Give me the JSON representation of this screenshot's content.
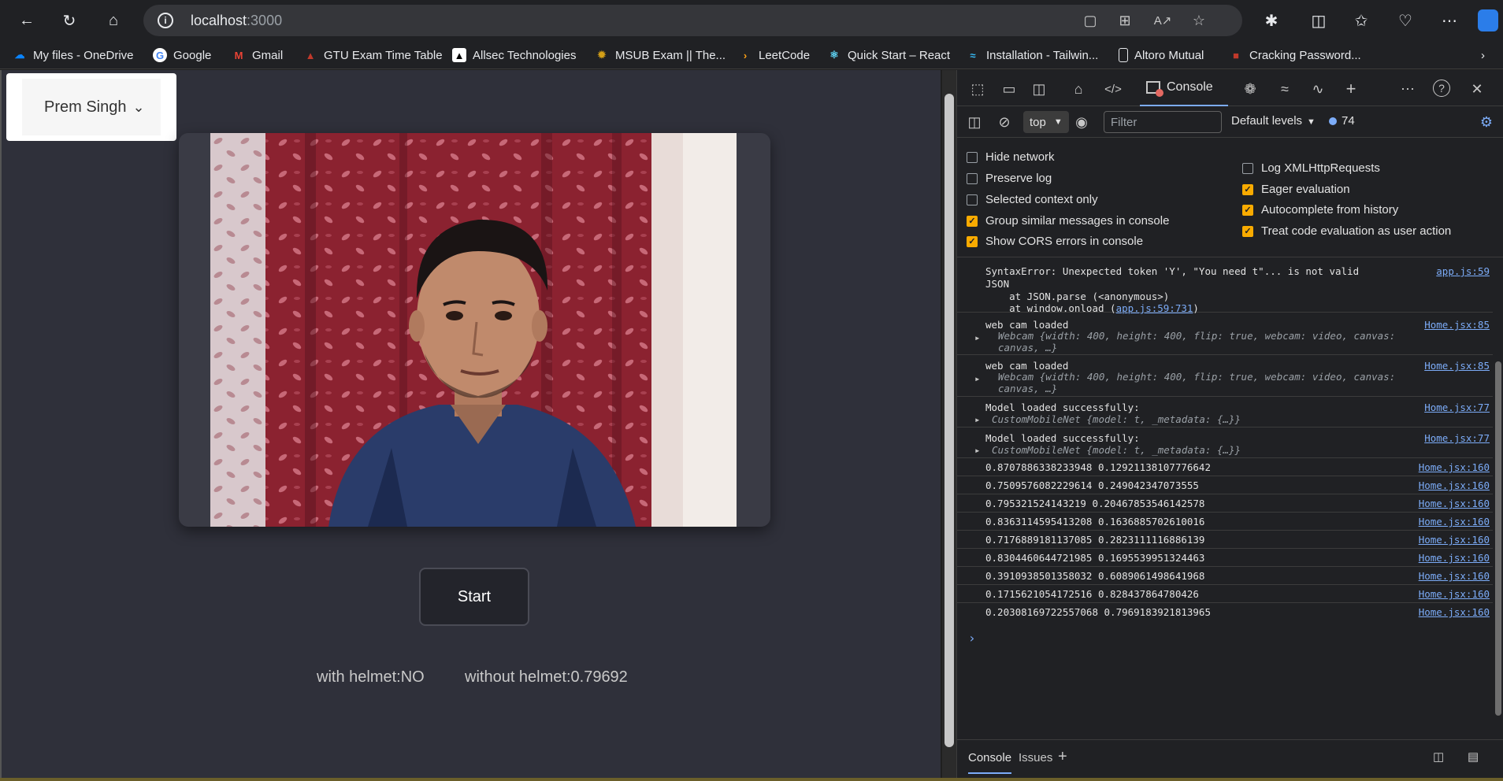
{
  "browser": {
    "url_host": "localhost",
    "url_port": ":3000",
    "bookmarks": [
      {
        "label": "My files - OneDrive",
        "icon": "onedrive-icon",
        "color": "#0a84ff"
      },
      {
        "label": "Google",
        "icon": "google-icon",
        "color": "#ffffff"
      },
      {
        "label": "Gmail",
        "icon": "gmail-icon",
        "color": "#ea4335"
      },
      {
        "label": "GTU Exam Time Table",
        "icon": "gtu-icon",
        "color": "#c0392b"
      },
      {
        "label": "Allsec Technologies",
        "icon": "allsec-icon",
        "color": "#ffffff"
      },
      {
        "label": "MSUB Exam || The...",
        "icon": "msub-icon",
        "color": "#d4a017"
      },
      {
        "label": "LeetCode",
        "icon": "leetcode-icon",
        "color": "#ffa116"
      },
      {
        "label": "Quick Start – React",
        "icon": "react-icon",
        "color": "#61dafb"
      },
      {
        "label": "Installation - Tailwin...",
        "icon": "tailwind-icon",
        "color": "#38bdf8"
      },
      {
        "label": "Altoro Mutual",
        "icon": "page-icon",
        "color": "#e8eaed"
      },
      {
        "label": "Cracking Password...",
        "icon": "cracking-icon",
        "color": "#c0392b"
      }
    ]
  },
  "app": {
    "user_menu_label": "Prem Singh",
    "start_label": "Start",
    "with_helmet": "with helmet:NO",
    "without_helmet": "without helmet:0.79692"
  },
  "devtools": {
    "console_tab": "Console",
    "context": "top",
    "filter_placeholder": "Filter",
    "levels": "Default levels",
    "message_count": "74",
    "settings_left": [
      {
        "label": "Hide network",
        "checked": false
      },
      {
        "label": "Preserve log",
        "checked": false
      },
      {
        "label": "Selected context only",
        "checked": false
      },
      {
        "label": "Group similar messages in console",
        "checked": true
      },
      {
        "label": "Show CORS errors in console",
        "checked": true
      }
    ],
    "settings_right": [
      {
        "label": "Log XMLHttpRequests",
        "checked": false
      },
      {
        "label": "Eager evaluation",
        "checked": true
      },
      {
        "label": "Autocomplete from history",
        "checked": true
      },
      {
        "label": "Treat code evaluation as user action",
        "checked": true
      }
    ],
    "error": {
      "line1": "SyntaxError: Unexpected token 'Y', \"You need t\"... is not valid",
      "line2": "JSON",
      "line3": "    at JSON.parse (<anonymous>)",
      "line4_prefix": "    at window.onload (",
      "line4_link": "app.js:59:731",
      "line4_suffix": ")",
      "source": "app.js:59"
    },
    "object_logs": [
      {
        "text": "web cam loaded",
        "obj1": "Webcam {width: 400, height: 400, flip: true, webcam: video, canvas:",
        "obj2": "canvas, …}",
        "source": "Home.jsx:85"
      },
      {
        "text": "web cam loaded",
        "obj1": "Webcam {width: 400, height: 400, flip: true, webcam: video, canvas:",
        "obj2": "canvas, …}",
        "source": "Home.jsx:85"
      },
      {
        "text": "Model loaded successfully:",
        "obj1": "CustomMobileNet {model: t, _metadata: {…}}",
        "obj2": "",
        "source": "Home.jsx:77"
      },
      {
        "text": "Model loaded successfully:",
        "obj1": "CustomMobileNet {model: t, _metadata: {…}}",
        "obj2": "",
        "source": "Home.jsx:77"
      }
    ],
    "number_logs": [
      {
        "text": "0.8707886338233948 0.12921138107776642",
        "source": "Home.jsx:160"
      },
      {
        "text": "0.7509576082229614 0.249042347073555",
        "source": "Home.jsx:160"
      },
      {
        "text": "0.795321524143219 0.20467853546142578",
        "source": "Home.jsx:160"
      },
      {
        "text": "0.8363114595413208 0.1636885702610016",
        "source": "Home.jsx:160"
      },
      {
        "text": "0.7176889181137085 0.2823111116886139",
        "source": "Home.jsx:160"
      },
      {
        "text": "0.8304460644721985 0.1695539951324463",
        "source": "Home.jsx:160"
      },
      {
        "text": "0.3910938501358032 0.6089061498641968",
        "source": "Home.jsx:160"
      },
      {
        "text": "0.1715621054172516 0.828437864780426",
        "source": "Home.jsx:160"
      },
      {
        "text": "0.20308169722557068 0.7969183921813965",
        "source": "Home.jsx:160"
      }
    ],
    "drawer_tabs": [
      "Console",
      "Issues"
    ]
  }
}
